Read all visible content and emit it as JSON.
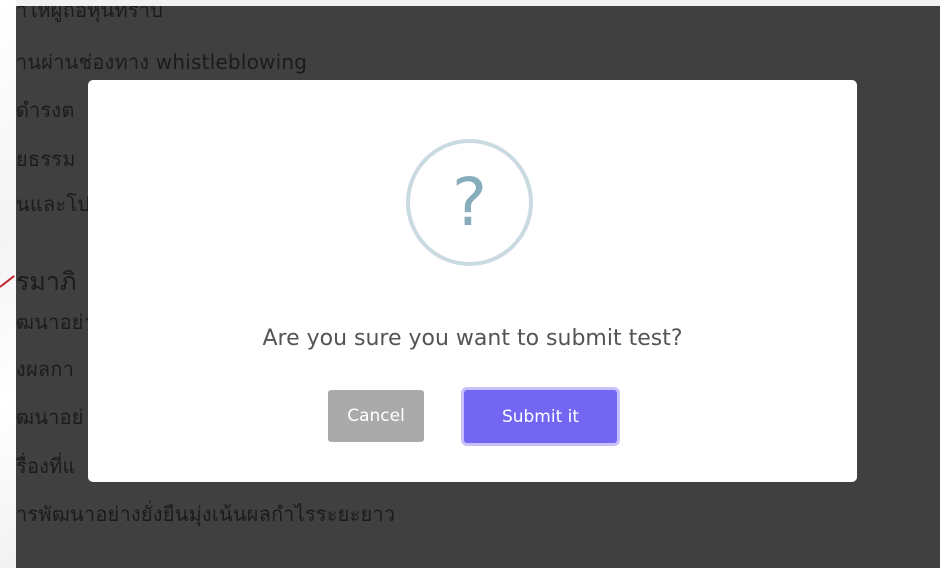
{
  "background_page": {
    "lines": [
      "าให้ผู้ถือหุ้นทราบ",
      "านผ่านช่องทาง whistleblowing",
      "ดำรงต",
      "ยธรรม",
      "นและโป",
      "รมาภิ",
      "ฒนาอย่า",
      "งผลกา",
      "ฒนาอย่",
      "รื่องที่แ",
      "ารพัฒนาอย่างยั่งยืนมุ่งเน้นผลกำไรระยะยาว"
    ]
  },
  "dialog": {
    "icon": "question-icon",
    "icon_glyph": "?",
    "title": "Are you sure you want to submit test?",
    "cancel_label": "Cancel",
    "confirm_label": "Submit it"
  },
  "colors": {
    "overlay": "#404040",
    "confirm_button": "#7266f2",
    "cancel_button": "#aaaaaa",
    "icon_ring": "#c9dae1",
    "icon_glyph": "#87adbd"
  }
}
